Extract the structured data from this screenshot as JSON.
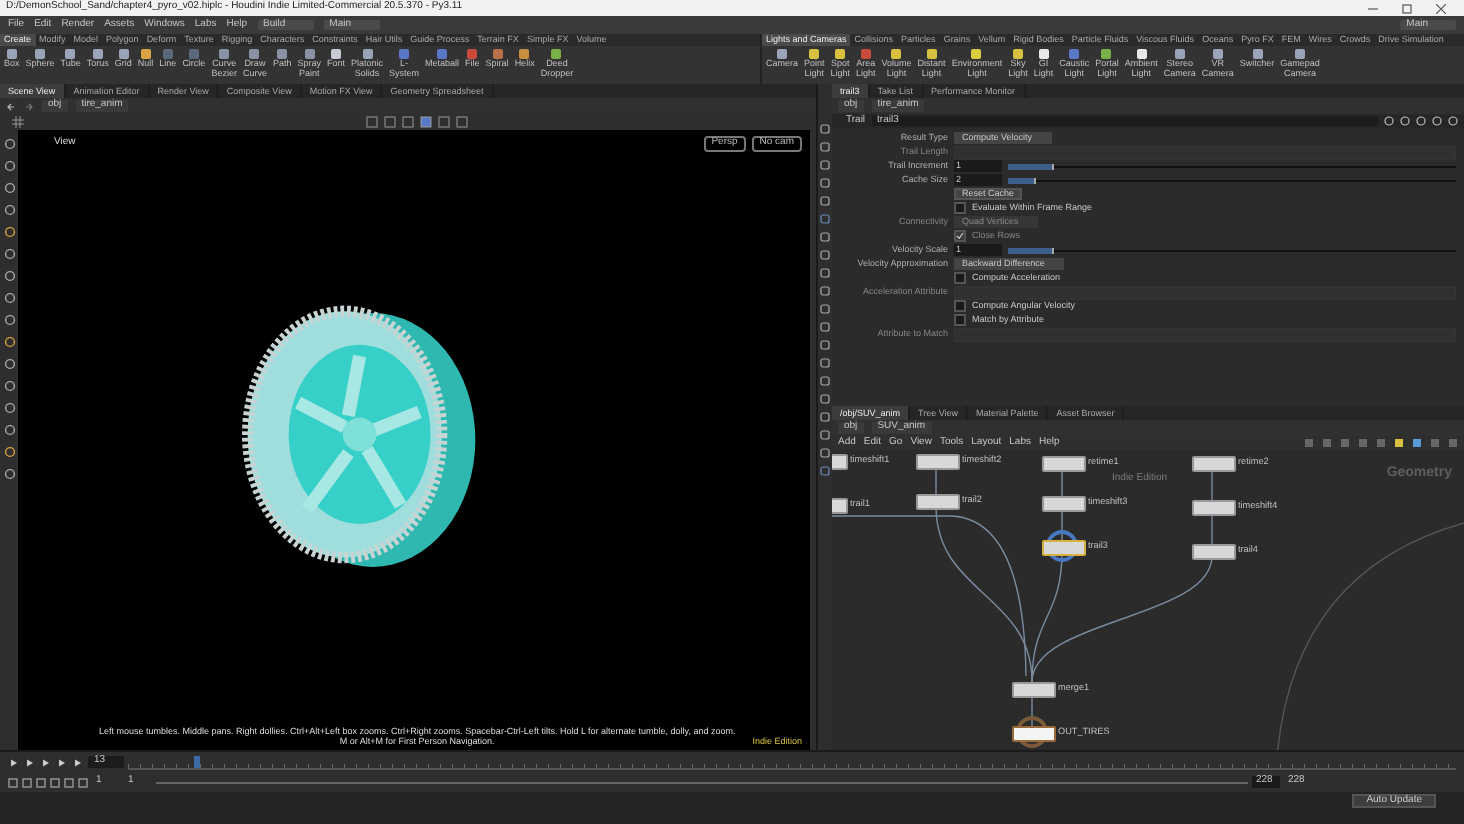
{
  "window": {
    "title": "D:/DemonSchool_Sand/chapter4_pyro_v02.hiplc - Houdini Indie Limited-Commercial 20.5.370 - Py3.11"
  },
  "menu": [
    "File",
    "Edit",
    "Render",
    "Assets",
    "Windows",
    "Labs",
    "Help"
  ],
  "desktop": "Build",
  "layout": "Main",
  "layout_right": "Main",
  "shelf_left": {
    "tabs": [
      {
        "label": "Create",
        "selected": true
      },
      {
        "label": "Modify",
        "selected": false
      },
      {
        "label": "Model",
        "selected": false
      },
      {
        "label": "Polygon",
        "selected": false
      },
      {
        "label": "Deform",
        "selected": false
      },
      {
        "label": "Texture",
        "selected": false
      },
      {
        "label": "Rigging",
        "selected": false
      },
      {
        "label": "Characters",
        "selected": false
      },
      {
        "label": "Constraints",
        "selected": false
      },
      {
        "label": "Hair Utils",
        "selected": false
      },
      {
        "label": "Guide Process",
        "selected": false
      },
      {
        "label": "Terrain FX",
        "selected": false
      },
      {
        "label": "Simple FX",
        "selected": false
      },
      {
        "label": "Volume",
        "selected": false
      }
    ],
    "tools": [
      {
        "label": "Box",
        "color": "#9aa4b8"
      },
      {
        "label": "Sphere",
        "color": "#9aa4b8"
      },
      {
        "label": "Tube",
        "color": "#9aa4b8"
      },
      {
        "label": "Torus",
        "color": "#9aa4b8"
      },
      {
        "label": "Grid",
        "color": "#9aa4b8"
      },
      {
        "label": "Null",
        "color": "#d9a441"
      },
      {
        "label": "Line",
        "color": "#5b6a7a"
      },
      {
        "label": "Circle",
        "color": "#5b6a7a"
      },
      {
        "label": "Curve Bezier",
        "color": "#8a93a3"
      },
      {
        "label": "Draw Curve",
        "color": "#8a93a3"
      },
      {
        "label": "Path",
        "color": "#8a93a3"
      },
      {
        "label": "Spray Paint",
        "color": "#8a93a3"
      },
      {
        "label": "Font",
        "color": "#c8ccd4"
      },
      {
        "label": "Platonic Solids",
        "color": "#9aa4b8"
      },
      {
        "label": "L-System",
        "color": "#5a78c8"
      },
      {
        "label": "Metaball",
        "color": "#5a78c8"
      },
      {
        "label": "File",
        "color": "#c84a3a"
      },
      {
        "label": "Spiral",
        "color": "#b87048"
      },
      {
        "label": "Helix",
        "color": "#c89040"
      },
      {
        "label": "Deed Dropper",
        "color": "#7ab048"
      }
    ]
  },
  "shelf_right": {
    "tabs": [
      {
        "label": "Lights and Cameras",
        "selected": true
      },
      {
        "label": "Collisions",
        "selected": false
      },
      {
        "label": "Particles",
        "selected": false
      },
      {
        "label": "Grains",
        "selected": false
      },
      {
        "label": "Vellum",
        "selected": false
      },
      {
        "label": "Rigid Bodies",
        "selected": false
      },
      {
        "label": "Particle Fluids",
        "selected": false
      },
      {
        "label": "Viscous Fluids",
        "selected": false
      },
      {
        "label": "Oceans",
        "selected": false
      },
      {
        "label": "Pyro FX",
        "selected": false
      },
      {
        "label": "FEM",
        "selected": false
      },
      {
        "label": "Wires",
        "selected": false
      },
      {
        "label": "Crowds",
        "selected": false
      },
      {
        "label": "Drive Simulation",
        "selected": false
      }
    ],
    "tools": [
      {
        "label": "Camera",
        "color": "#9aa4b8"
      },
      {
        "label": "Point Light",
        "color": "#d8c040"
      },
      {
        "label": "Spot Light",
        "color": "#d8c040"
      },
      {
        "label": "Area Light",
        "color": "#c84a3a"
      },
      {
        "label": "Volume Light",
        "color": "#d8c040"
      },
      {
        "label": "Distant Light",
        "color": "#d8c040"
      },
      {
        "label": "Environment Light",
        "color": "#d8d040"
      },
      {
        "label": "Sky Light",
        "color": "#d8c040"
      },
      {
        "label": "GI Light",
        "color": "#e8e8e8"
      },
      {
        "label": "Caustic Light",
        "color": "#5a78c8"
      },
      {
        "label": "Portal Light",
        "color": "#7ab048"
      },
      {
        "label": "Ambient Light",
        "color": "#e8e8e8"
      },
      {
        "label": "Stereo Camera",
        "color": "#9aa4b8"
      },
      {
        "label": "VR Camera",
        "color": "#9aa4b8"
      },
      {
        "label": "Switcher",
        "color": "#9aa4b8"
      },
      {
        "label": "Gamepad Camera",
        "color": "#9aa4b8"
      }
    ]
  },
  "viewer": {
    "tabs": [
      {
        "label": "Scene View",
        "selected": true
      },
      {
        "label": "Animation Editor",
        "selected": false
      },
      {
        "label": "Render View",
        "selected": false
      },
      {
        "label": "Composite View",
        "selected": false
      },
      {
        "label": "Motion FX View",
        "selected": false
      },
      {
        "label": "Geometry Spreadsheet",
        "selected": false
      }
    ],
    "path": [
      "obj",
      "tire_anim"
    ],
    "view_label": "View",
    "camera_buttons": [
      "Persp",
      "No cam"
    ],
    "hint": "Left mouse tumbles. Middle pans. Right dollies. Ctrl+Alt+Left box zooms. Ctrl+Right zooms. Spacebar-Ctrl-Left tilts. Hold L for alternate tumble, dolly, and zoom. M or Alt+M for First Person Navigation.",
    "edition": "Indie Edition"
  },
  "parameters": {
    "tabs": [
      {
        "label": "trail3",
        "selected": true
      },
      {
        "label": "Take List",
        "selected": false
      },
      {
        "label": "Performance Monitor",
        "selected": false
      }
    ],
    "path": [
      "obj",
      "tire_anim"
    ],
    "node_type": "Trail",
    "node_name": "trail3",
    "rows": [
      {
        "kind": "menu",
        "label": "Result Type",
        "value": "Compute Velocity",
        "disabled": false
      },
      {
        "kind": "text",
        "label": "Trail Length",
        "disabled": true
      },
      {
        "kind": "slider",
        "label": "Trail Increment",
        "value": "1",
        "level": 0.1,
        "disabled": false
      },
      {
        "kind": "slider",
        "label": "Cache Size",
        "value": "2",
        "level": 0.06,
        "disabled": false
      },
      {
        "kind": "button",
        "value": "Reset Cache",
        "disabled": false
      },
      {
        "kind": "check",
        "value": "Evaluate Within Frame Range",
        "checked": false,
        "disabled": false
      },
      {
        "kind": "menu",
        "label": "Connectivity",
        "value": "Quad Vertices",
        "disabled": true
      },
      {
        "kind": "check",
        "value": "Close Rows",
        "checked": true,
        "disabled": true
      },
      {
        "kind": "slider",
        "label": "Velocity Scale",
        "value": "1",
        "level": 0.1,
        "disabled": false
      },
      {
        "kind": "menu",
        "label": "Velocity Approximation",
        "value": "Backward Difference",
        "disabled": false
      },
      {
        "kind": "check",
        "value": "Compute Acceleration",
        "checked": false,
        "disabled": false
      },
      {
        "kind": "text",
        "label": "Acceleration Attribute",
        "disabled": true
      },
      {
        "kind": "check",
        "value": "Compute Angular Velocity",
        "checked": false,
        "disabled": false
      },
      {
        "kind": "check",
        "value": "Match by Attribute",
        "checked": false,
        "disabled": false
      },
      {
        "kind": "text",
        "label": "Attribute to Match",
        "disabled": true
      }
    ]
  },
  "network": {
    "tabs": [
      {
        "label": "/obj/SUV_anim",
        "selected": true
      },
      {
        "label": "Tree View",
        "selected": false
      },
      {
        "label": "Material Palette",
        "selected": false
      },
      {
        "label": "Asset Browser",
        "selected": false
      }
    ],
    "path": [
      "obj",
      "SUV_anim"
    ],
    "menu": [
      "Add",
      "Edit",
      "Go",
      "View",
      "Tools",
      "Layout",
      "Labs",
      "Help"
    ],
    "context": "Geometry",
    "edition": "Indie Edition",
    "nodes": [
      {
        "name": "timeshift1",
        "selected": false,
        "display": false
      },
      {
        "name": "timeshift2",
        "selected": false,
        "display": false
      },
      {
        "name": "trail1",
        "selected": false,
        "display": false
      },
      {
        "name": "trail2",
        "selected": false,
        "display": false
      },
      {
        "name": "retime1",
        "selected": false,
        "display": false
      },
      {
        "name": "timeshift3",
        "selected": false,
        "display": false
      },
      {
        "name": "trail3",
        "selected": true,
        "display": false
      },
      {
        "name": "retime2",
        "selected": false,
        "display": false
      },
      {
        "name": "timeshift4",
        "selected": false,
        "display": false
      },
      {
        "name": "trail4",
        "selected": false,
        "display": false
      },
      {
        "name": "merge1",
        "selected": false,
        "display": false
      },
      {
        "name": "OUT_TIRES",
        "selected": false,
        "display": true
      }
    ]
  },
  "timeline": {
    "frame": "13",
    "start": "1",
    "range_start": "1",
    "range_end": "228",
    "end": "228",
    "auto_update": "Auto Update",
    "level": 0.05
  }
}
